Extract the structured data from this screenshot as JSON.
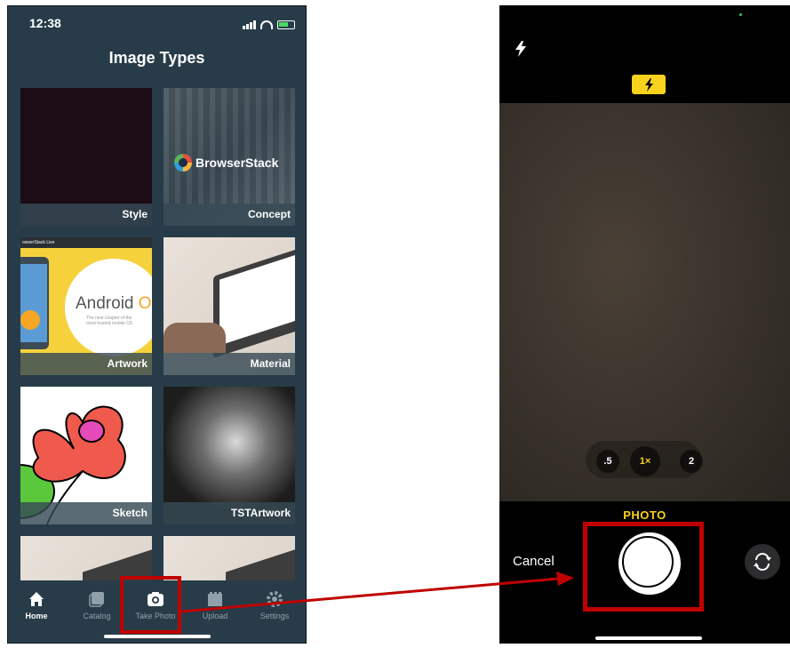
{
  "left_phone": {
    "status": {
      "time": "12:38"
    },
    "title": "Image Types",
    "tiles": [
      {
        "label": "Style"
      },
      {
        "label": "Concept",
        "logo_text": "BrowserStack"
      },
      {
        "label": "Artwork",
        "banner": "owserStack Live",
        "headline": "Android",
        "headline_accent": "O",
        "subtext": "The next chapter of the most trusted mobile OS"
      },
      {
        "label": "Material"
      },
      {
        "label": "Sketch"
      },
      {
        "label": "TSTArtwork"
      }
    ],
    "tabs": [
      {
        "label": "Home",
        "icon": "home-icon",
        "active": true
      },
      {
        "label": "Catalog",
        "icon": "gallery-icon",
        "active": false
      },
      {
        "label": "Take Photo",
        "icon": "camera-icon",
        "active": false
      },
      {
        "label": "Upload",
        "icon": "film-icon",
        "active": false
      },
      {
        "label": "Settings",
        "icon": "gear-icon",
        "active": false
      }
    ]
  },
  "right_phone": {
    "zoom_levels": [
      ".5",
      "1×",
      "2"
    ],
    "selected_zoom": "1×",
    "mode": "PHOTO",
    "cancel_label": "Cancel"
  },
  "colors": {
    "app_bg": "#273c48",
    "highlight": "#c00000",
    "camera_yellow": "#f8d21c"
  }
}
